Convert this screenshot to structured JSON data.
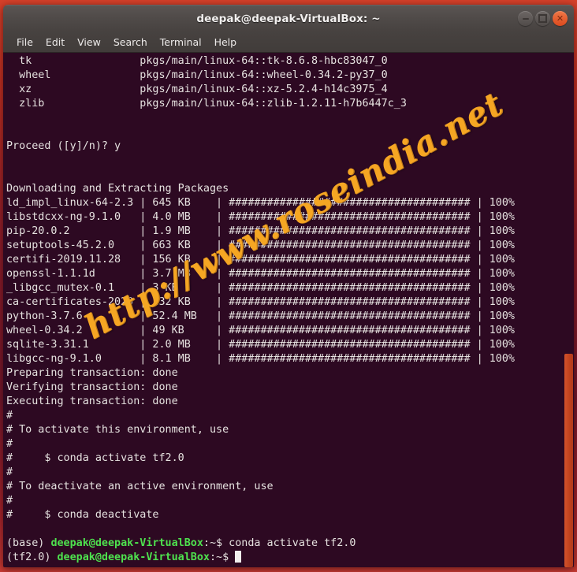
{
  "window": {
    "title": "deepak@deepak-VirtualBox: ~",
    "controls": [
      {
        "name": "minimize",
        "glyph": "—"
      },
      {
        "name": "maximize",
        "glyph": "□"
      },
      {
        "name": "close",
        "glyph": "×"
      }
    ]
  },
  "menubar": {
    "items": [
      "File",
      "Edit",
      "View",
      "Search",
      "Terminal",
      "Help"
    ]
  },
  "terminal": {
    "background_color": "#2d0922",
    "foreground_color": "#e6e2e0",
    "prompt_user_color": "#4ee24e",
    "watermark": "http://www.roseindia.net",
    "watermark_color": "#f5a623",
    "lines": [
      "  tk                 pkgs/main/linux-64::tk-8.6.8-hbc83047_0",
      "  wheel              pkgs/main/linux-64::wheel-0.34.2-py37_0",
      "  xz                 pkgs/main/linux-64::xz-5.2.4-h14c3975_4",
      "  zlib               pkgs/main/linux-64::zlib-1.2.11-h7b6447c_3",
      "",
      "",
      "Proceed ([y]/n)? y",
      "",
      "",
      "Downloading and Extracting Packages",
      "ld_impl_linux-64-2.3 | 645 KB    | ###################################### | 100%",
      "libstdcxx-ng-9.1.0   | 4.0 MB    | ###################################### | 100%",
      "pip-20.0.2           | 1.9 MB    | ###################################### | 100%",
      "setuptools-45.2.0    | 663 KB    | ###################################### | 100%",
      "certifi-2019.11.28   | 156 KB    | ###################################### | 100%",
      "openssl-1.1.1d       | 3.7 MB    | ###################################### | 100%",
      "_libgcc_mutex-0.1    | 3 KB      | ###################################### | 100%",
      "ca-certificates-2020 | 132 KB    | ###################################### | 100%",
      "python-3.7.6         | 52.4 MB   | ###################################### | 100%",
      "wheel-0.34.2         | 49 KB     | ###################################### | 100%",
      "sqlite-3.31.1        | 2.0 MB    | ###################################### | 100%",
      "libgcc-ng-9.1.0      | 8.1 MB    | ###################################### | 100%",
      "Preparing transaction: done",
      "Verifying transaction: done",
      "Executing transaction: done",
      "#",
      "# To activate this environment, use",
      "#",
      "#     $ conda activate tf2.0",
      "#",
      "# To deactivate an active environment, use",
      "#",
      "#     $ conda deactivate",
      ""
    ],
    "prompt_lines": [
      {
        "env": "(base) ",
        "user_host": "deepak@deepak-VirtualBox",
        "path": ":~$ ",
        "command": "conda activate tf2.0",
        "cursor": false
      },
      {
        "env": "(tf2.0) ",
        "user_host": "deepak@deepak-VirtualBox",
        "path": ":~$ ",
        "command": "",
        "cursor": true
      }
    ]
  },
  "scrollbar": {
    "thumb_color": "#c4441f",
    "position_label": "bottom"
  }
}
